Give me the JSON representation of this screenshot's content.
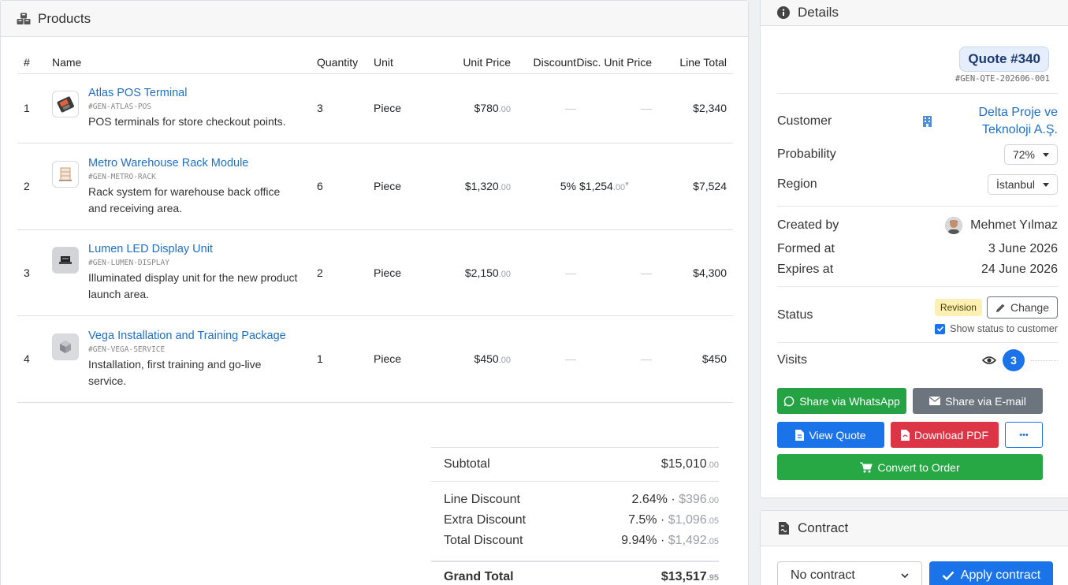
{
  "products": {
    "title": "Products",
    "columns": [
      "#",
      "Name",
      "Quantity",
      "Unit",
      "Unit Price",
      "Discount",
      "Disc. Unit Price",
      "Line Total"
    ],
    "rows": [
      {
        "num": "1",
        "name": "Atlas POS Terminal",
        "code": "#GEN-ATLAS-POS",
        "desc": "POS terminals for store checkout points.",
        "qty": "3",
        "unit": "Piece",
        "price": "$780",
        "price_cents": ".00",
        "discount": "—",
        "disc_price": "—",
        "disc_price_cents": "",
        "total": "$2,340"
      },
      {
        "num": "2",
        "name": "Metro Warehouse Rack Module",
        "code": "#GEN-METRO-RACK",
        "desc": "Rack system for warehouse back office and receiving area.",
        "qty": "6",
        "unit": "Piece",
        "price": "$1,320",
        "price_cents": ".00",
        "discount": "5%",
        "disc_price": "$1,254",
        "disc_price_cents": ".00",
        "total": "$7,524"
      },
      {
        "num": "3",
        "name": "Lumen LED Display Unit",
        "code": "#GEN-LUMEN-DISPLAY",
        "desc": "Illuminated display unit for the new product launch area.",
        "qty": "2",
        "unit": "Piece",
        "price": "$2,150",
        "price_cents": ".00",
        "discount": "—",
        "disc_price": "—",
        "disc_price_cents": "",
        "total": "$4,300"
      },
      {
        "num": "4",
        "name": "Vega Installation and Training Package",
        "code": "#GEN-VEGA-SERVICE",
        "desc": "Installation, first training and go-live service.",
        "qty": "1",
        "unit": "Piece",
        "price": "$450",
        "price_cents": ".00",
        "discount": "—",
        "disc_price": "—",
        "disc_price_cents": "",
        "total": "$450"
      }
    ]
  },
  "summary": {
    "subtotal_label": "Subtotal",
    "subtotal": "$15,010",
    "subtotal_cents": ".00",
    "line_discount_label": "Line Discount",
    "line_discount_pct": "2.64%",
    "line_discount_amt": "$396",
    "line_discount_cents": ".00",
    "extra_discount_label": "Extra Discount",
    "extra_discount_pct": "7.5%",
    "extra_discount_amt": "$1,096",
    "extra_discount_cents": ".05",
    "total_discount_label": "Total Discount",
    "total_discount_pct": "9.94%",
    "total_discount_amt": "$1,492",
    "total_discount_cents": ".05",
    "grand_total_label": "Grand Total",
    "grand_total": "$13,517",
    "grand_total_cents": ".95",
    "dot": "·"
  },
  "details": {
    "title": "Details",
    "quote_number": "Quote #340",
    "quote_code": "#GEN-QTE-202606-001",
    "customer_label": "Customer",
    "customer_name_1": "Delta Proje ve",
    "customer_name_2": "Teknoloji A.Ş.",
    "probability_label": "Probability",
    "probability_value": "72%",
    "region_label": "Region",
    "region_value": "İstanbul",
    "created_by_label": "Created by",
    "created_by_value": "Mehmet Yılmaz",
    "formed_at_label": "Formed at",
    "formed_at_value": "3 June 2026",
    "expires_at_label": "Expires at",
    "expires_at_value": "24 June 2026",
    "status_label": "Status",
    "status_value": "Revision",
    "change_label": "Change",
    "show_status_label": "Show status to customer",
    "visits_label": "Visits",
    "visits_count": "3"
  },
  "actions": {
    "whatsapp": "Share via WhatsApp",
    "email": "Share via E-mail",
    "view": "View Quote",
    "pdf": "Download PDF",
    "more": "•••",
    "convert": "Convert to Order"
  },
  "contract": {
    "title": "Contract",
    "select_value": "No contract",
    "apply": "Apply contract"
  },
  "colors": {
    "link": "#1f6fc5",
    "whatsapp": "#25a244",
    "email": "#6c757d",
    "view": "#1a73e8",
    "pdf": "#dc3545",
    "convert": "#28a745"
  }
}
